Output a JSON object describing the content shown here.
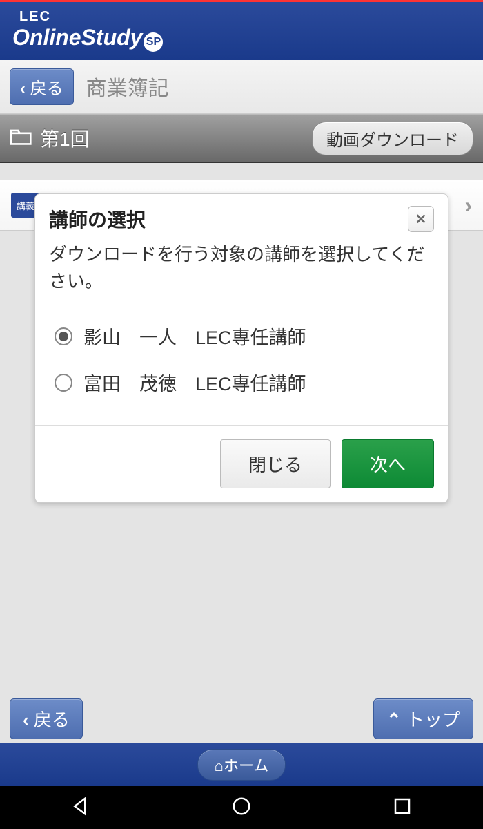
{
  "logo": {
    "lec": "LEC",
    "main": "OnlineStudy",
    "sp": "SP"
  },
  "subheader": {
    "back": "戻る",
    "breadcrumb": "商業簿記"
  },
  "section": {
    "title": "第1回",
    "download": "動画ダウンロード"
  },
  "list_row": {
    "icon_text": "講義",
    "label": "講義"
  },
  "dialog": {
    "title": "講師の選択",
    "desc": "ダウンロードを行う対象の講師を選択してください。",
    "options": [
      {
        "name": "影山　一人　LEC専任講師",
        "selected": true
      },
      {
        "name": "富田　茂徳　LEC専任講師",
        "selected": false
      }
    ],
    "close_label": "閉じる",
    "next_label": "次へ"
  },
  "footer": {
    "back": "戻る",
    "top": "トップ",
    "home": "ホーム"
  }
}
